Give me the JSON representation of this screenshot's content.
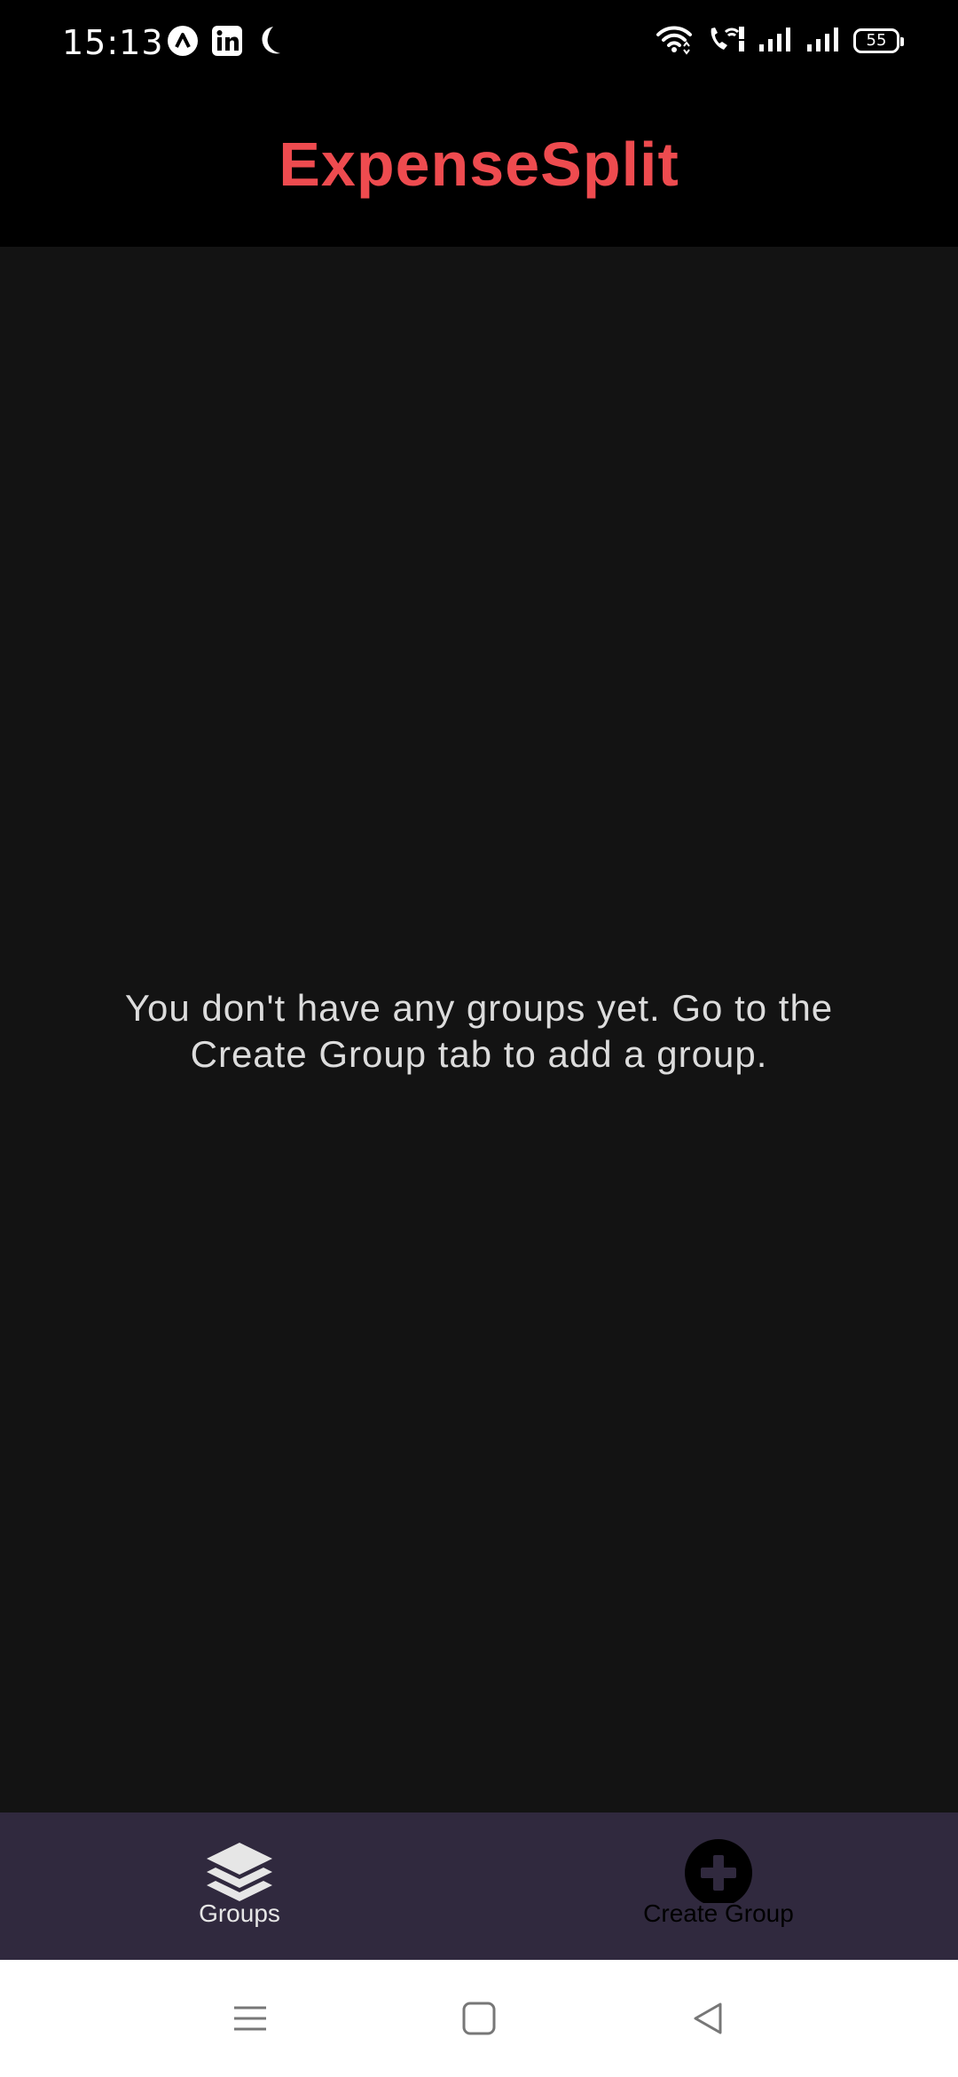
{
  "status_bar": {
    "time": "15:13",
    "left_icons": [
      "app-notification-icon",
      "linkedin-icon",
      "moon-icon"
    ],
    "right_icons": [
      "wifi-icon",
      "wifi-calling-icon",
      "signal-icon",
      "signal-icon"
    ],
    "battery_level": "55"
  },
  "header": {
    "title": "ExpenseSplit",
    "title_color": "#ee4b4f"
  },
  "main": {
    "empty_message": "You don't have any groups yet. Go to the Create Group tab to add a group."
  },
  "tabs": [
    {
      "label": "Groups",
      "icon": "layers-icon",
      "active": true
    },
    {
      "label": "Create Group",
      "icon": "plus-circle-icon",
      "active": false
    }
  ],
  "nav_bar": {
    "buttons": [
      "menu-icon",
      "home-square-icon",
      "back-triangle-icon"
    ]
  },
  "colors": {
    "header_bg": "#000000",
    "content_bg": "#131313",
    "tab_bar_bg": "#30293e",
    "accent": "#ee4b4f"
  }
}
